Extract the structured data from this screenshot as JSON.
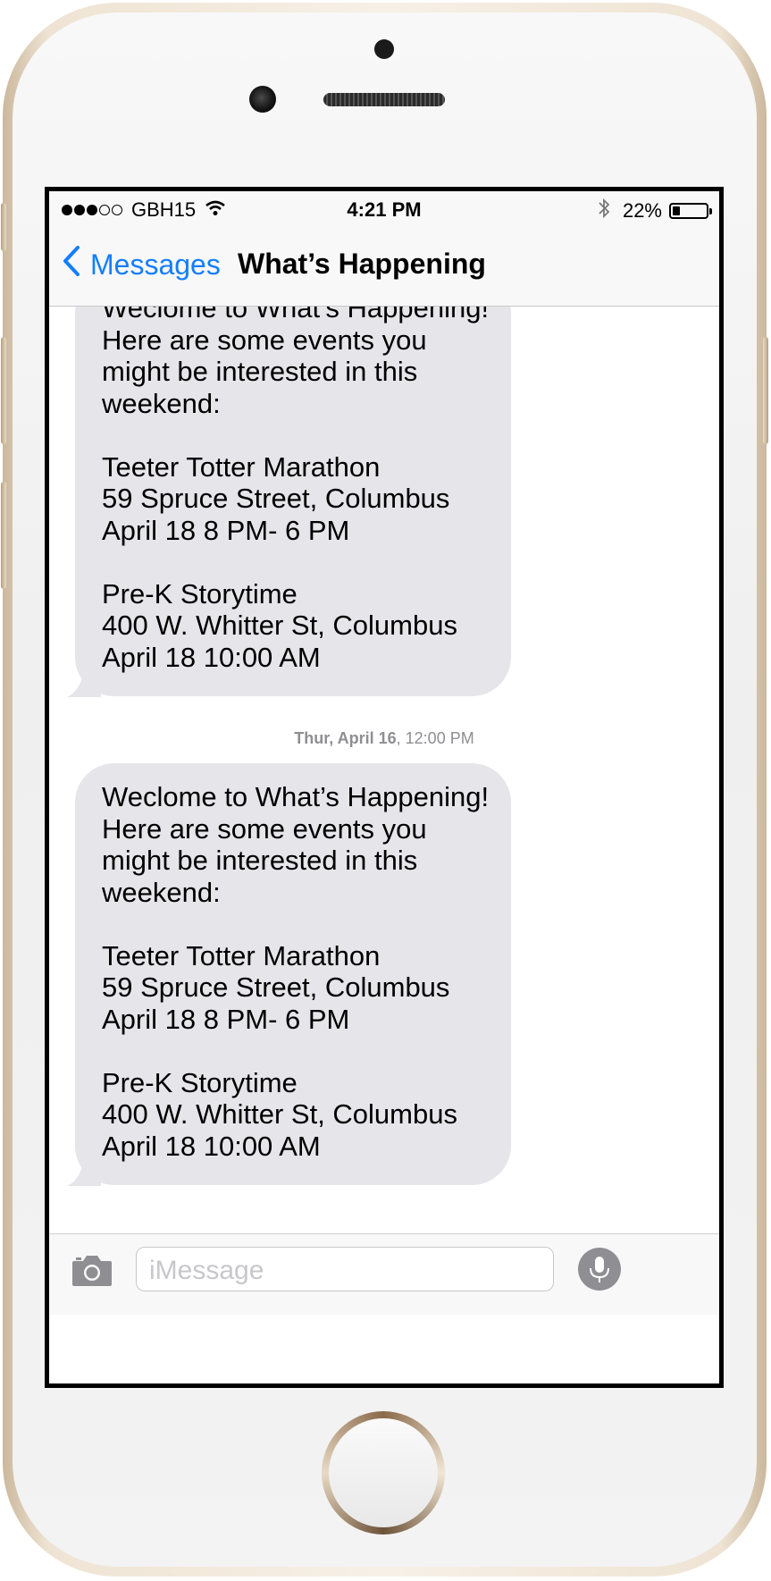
{
  "status_bar": {
    "signal_dots": [
      true,
      true,
      true,
      false,
      false
    ],
    "carrier": "GBH15",
    "time": "4:21 PM",
    "battery": "22%",
    "battery_level": 0.22
  },
  "nav": {
    "back_label": "Messages",
    "title": "What’s Happening"
  },
  "messages": [
    {
      "sender": "incoming",
      "lines": [
        "Weclome to What’s Happening!",
        "Here are some events you",
        "might be interested in this",
        "weekend:",
        "",
        "Teeter Totter Marathon",
        "59 Spruce Street, Columbus",
        "April 18 8 PM- 6 PM",
        "",
        "Pre-K Storytime",
        "400 W. Whitter St, Columbus",
        "April 18 10:00 AM"
      ]
    },
    {
      "sender": "incoming",
      "lines": [
        "Weclome to What’s Happening!",
        "Here are some events you",
        "might be interested in this",
        "weekend:",
        "",
        "Teeter Totter Marathon",
        "59 Spruce Street, Columbus",
        "April 18 8 PM- 6 PM",
        "",
        "Pre-K Storytime",
        "400 W. Whitter St, Columbus",
        "April 18 10:00 AM"
      ]
    }
  ],
  "timestamp": {
    "day": "Thur, April 16",
    "time": ", 12:00 PM"
  },
  "input": {
    "placeholder": "iMessage"
  },
  "icons": {
    "back": "chevron-left-icon",
    "camera": "camera-icon",
    "mic": "microphone-icon",
    "wifi": "wifi-icon",
    "bluetooth": "bluetooth-icon",
    "battery": "battery-icon"
  },
  "colors": {
    "accent": "#147efb",
    "bubble": "#e5e5ea",
    "timestamp": "#8e8e93"
  }
}
